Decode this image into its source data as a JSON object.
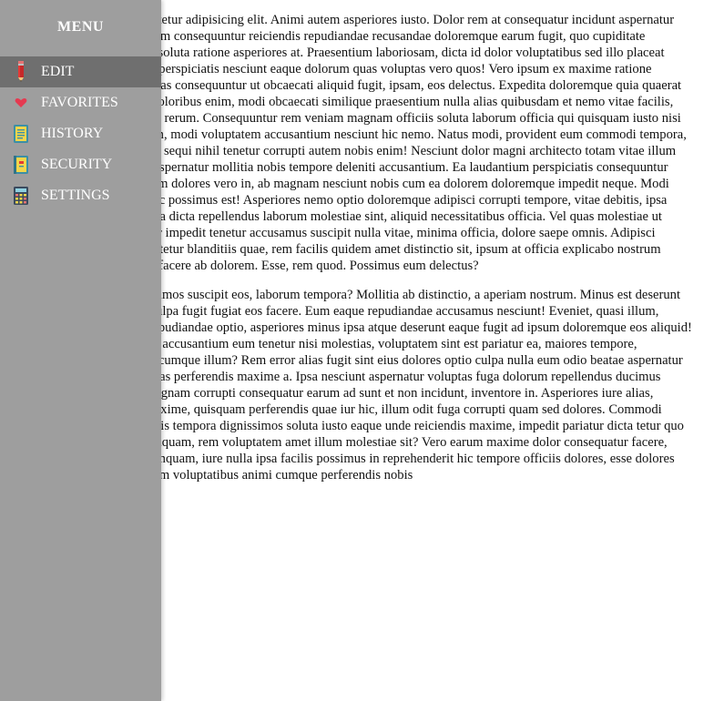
{
  "sidebar": {
    "title": "MENU",
    "items": [
      {
        "label": "EDIT",
        "icon": "pencil-icon",
        "active": true
      },
      {
        "label": "FAVORITES",
        "icon": "heart-icon",
        "active": false
      },
      {
        "label": "HISTORY",
        "icon": "notebook-icon",
        "active": false
      },
      {
        "label": "SECURITY",
        "icon": "lock-book-icon",
        "active": false
      },
      {
        "label": "SETTINGS",
        "icon": "calculator-icon",
        "active": false
      }
    ]
  },
  "content": {
    "paragraphs": [
      "Lorem ipsum dolor sit amet consectetur adipisicing elit. Animi autem asperiores iusto. Dolor rem at consequatur incidunt aspernatur earum minima quisquam quae. Ipsam consequuntur reiciendis repudiandae recusandae doloremque earum fugit, quo cupiditate possimus quibusdam nemo, earum soluta ratione asperiores at. Praesentium laboriosam, dicta id dolor voluptatibus sed illo placeat enim soluta recusandae nobis fugit perspiciatis nesciunt eaque dolorum quas voluptas vero quos! Vero ipsum ex maxime ratione corrupti! Aperiam harum tenetur quas consequuntur ut obcaecati aliquid fugit, ipsam, eos delectus. Expedita doloremque quia quaerat dolore sint reprehenderit velit hic doloribus enim, modi obcaecati similique praesentium nulla alias quibusdam et nemo vitae facilis, fugiat soluta magnam ipsa. Veniam, rerum. Consequuntur rem veniam magnam officiis soluta laborum officia qui quisquam iusto nisi vel quia culpa ratione tempore illum, modi voluptatem accusantium nesciunt hic nemo. Natus modi, provident eum commodi tempora, esse dolorum dolor ratione nesciunt sequi nihil tenetur corrupti autem nobis enim! Nesciunt dolor magni architecto totam vitae illum aut harum, deserunt reprehenderit aspernatur mollitia nobis tempore deleniti accusantium. Ea laudantium perspiciatis consequuntur fuga debitis a necessitatibus dolorum dolores vero in, ab magnam nesciunt nobis cum ea dolorem doloremque impedit neque. Modi ipsum, blanditiis in aperiam eum hic possimus est! Asperiores nemo optio doloremque adipisci corrupti tempore, vitae debitis, ipsa incidunt aperiam iusto eligendi nulla dicta repellendus laborum molestiae sint, aliquid necessitatibus officia. Vel quas molestiae ut asperiores recusandae consequuntur impedit tenetur accusamus suscipit nulla vitae, minima officia, dolore saepe omnis. Adipisci veritatis quaerat eius itaque, consectetur blanditiis quae, rem facilis quidem amet distinctio sit, ipsum at officia explicabo nostrum voluptates necessitatibus excepturi facere ab dolorem. Esse, rem quod. Possimus eum delectus?",
      "Quae corrupti dolorum eius dignissimos suscipit eos, laborum tempora? Mollitia ab distinctio, a aperiam nostrum. Minus est deserunt eos animi, repudiandae similique culpa fugit fugiat eos facere. Eum eaque repudiandae accusamus nesciunt! Eveniet, quasi illum, labore maxime eligendi dolorum repudiandae optio, asperiores minus ipsa atque deserunt eaque fugit ad ipsum doloremque eos aliquid! Eius culpa sit nobis quia natus fuga accusantium eum tenetur nisi molestias, voluptatem sint est pariatur ea, maiores tempore, temporibus at quae libero aut iusto cumque illum? Rem error alias fugit sint eius dolores optio culpa nulla eum odio beatae aspernatur porro tempore numquam magni, quas perferendis maxime a. Ipsa nesciunt aspernatur voluptas fuga dolorum repellendus ducimus ullam quaerat alias eum suscipit magnam corrupti consequatur earum ad sunt et non incidunt, inventore in. Asperiores iure alias, praesentium aut vel ut, magnam maxime, quisquam perferendis quae iur hic, illum odit fuga corrupti quam sed dolores. Commodi quam ex tenetur reprehenderit debitis tempora dignissimos soluta iusto eaque unde reiciendis maxime, impedit pariatur dicta tetur quo necessitatibus? Voluptates facere aliquam, rem voluptatem amet illum molestiae sit? Vero earum maxime dolor consequatur facere, ullam voluptatibus veniam eum numquam, iure nulla ipsa facilis possimus in reprehenderit hic tempore officiis dolores, esse dolores illum voluptate natus. Vero quisquam voluptatibus animi cumque perferendis nobis"
    ]
  },
  "colors": {
    "sidebar_bg": "#9e9e9e",
    "active_item_bg": "#6f6f6f",
    "menu_text": "#ffffff",
    "content_text": "#111111"
  }
}
